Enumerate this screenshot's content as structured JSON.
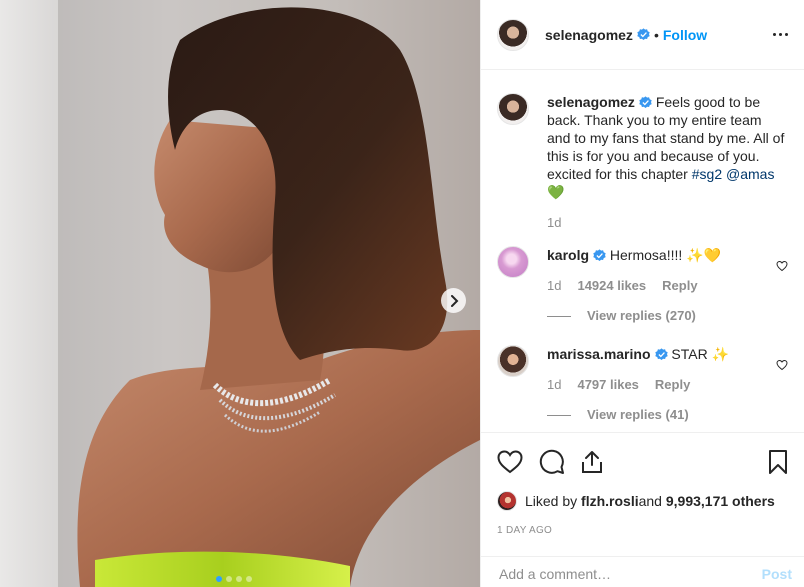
{
  "header": {
    "username": "selenagomez",
    "separator": "•",
    "follow_label": "Follow",
    "verified_icon": "verified-badge-icon",
    "more_icon": "more-options-icon"
  },
  "caption": {
    "username": "selenagomez",
    "text": "Feels good to be back. Thank you to my entire team and to my fans that stand by me. All of this is for you and because of you. excited for this chapter ",
    "hashtag": "#sg2",
    "mention": "@amas",
    "emoji": "💚",
    "time": "1d"
  },
  "comments": [
    {
      "username": "karolg",
      "text": "Hermosa!!!! ✨💛",
      "time": "1d",
      "likes": "14924 likes",
      "reply_label": "Reply",
      "view_replies": "View replies (270)"
    },
    {
      "username": "marissa.marino",
      "text": "STAR ✨",
      "time": "1d",
      "likes": "4797 likes",
      "reply_label": "Reply",
      "view_replies": "View replies (41)"
    }
  ],
  "likes": {
    "prefix": "Liked by ",
    "user": "flzh.rosli",
    "conjunction": " and ",
    "others": "9,993,171 others"
  },
  "timestamp": "1 DAY AGO",
  "comment_box": {
    "placeholder": "Add a comment…",
    "post_label": "Post"
  },
  "colors": {
    "accent": "#0095f6",
    "post_disabled": "#b2dffc",
    "muted": "#8e8e8e",
    "text": "#262626"
  },
  "carousel": {
    "active_index": 1,
    "count": 4
  }
}
